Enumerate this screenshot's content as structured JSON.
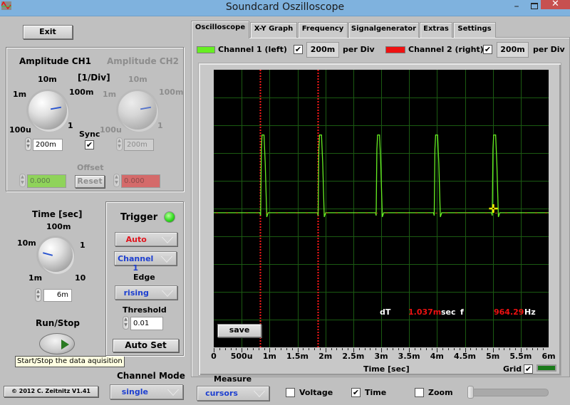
{
  "window": {
    "title": "Soundcard Oszilloscope",
    "controls": {
      "minimize": "–",
      "maximize": "□",
      "close": "✕"
    }
  },
  "left_panel": {
    "exit_label": "Exit",
    "amplitude": {
      "ch1_title": "Amplitude CH1",
      "ch2_title": "Amplitude CH2",
      "unit_label": "[1/Div]",
      "knob_labels": [
        "100u",
        "1m",
        "10m",
        "100m",
        "1"
      ],
      "ch1_value": "200m",
      "ch2_value": "200m",
      "sync_label": "Sync",
      "sync_checked": true,
      "offset_label": "Offset",
      "offset_ch1": "0.000",
      "offset_ch2": "0.000",
      "reset_label": "Reset"
    },
    "time": {
      "title": "Time [sec]",
      "knob_labels": [
        "1m",
        "10m",
        "100m",
        "1",
        "10"
      ],
      "value": "6m"
    },
    "run_stop": {
      "label": "Run/Stop",
      "tooltip": "Start/Stop the data aquisition"
    },
    "trigger": {
      "title": "Trigger",
      "mode": "Auto",
      "source": "Channel 1",
      "edge_label": "Edge",
      "edge": "rising",
      "threshold_label": "Threshold",
      "threshold": "0.01",
      "auto_set_label": "Auto Set",
      "led_color": "#33dd22"
    },
    "channel_mode": {
      "label": "Channel Mode",
      "value": "single"
    },
    "copyright": "© 2012  C. Zeitnitz V1.41"
  },
  "tabs": [
    {
      "label": "Oscilloscope",
      "active": true
    },
    {
      "label": "X-Y Graph",
      "active": false
    },
    {
      "label": "Frequency",
      "active": false
    },
    {
      "label": "Signalgenerator",
      "active": false
    },
    {
      "label": "Extras",
      "active": false
    },
    {
      "label": "Settings",
      "active": false
    }
  ],
  "channels": {
    "ch1": {
      "label": "Channel 1 (left)",
      "color": "#66ee22",
      "checked": true,
      "per_div": "200m",
      "per_div_label": "per Div"
    },
    "ch2": {
      "label": "Channel 2 (right)",
      "color": "#ee1111",
      "checked": true,
      "per_div": "200m",
      "per_div_label": "per Div"
    }
  },
  "scope": {
    "save_label": "save",
    "readout": {
      "dT_label": "dT",
      "dT_value": "1.037m",
      "dT_unit": "sec",
      "f_label": "f",
      "f_value": "964.29",
      "f_unit": "Hz"
    },
    "grid_label": "Grid",
    "grid_checked": true,
    "grid_color": "#1a7a1a"
  },
  "measure": {
    "label": "Measure",
    "mode": "cursors",
    "voltage_label": "Voltage",
    "voltage_checked": false,
    "time_label": "Time",
    "time_checked": true,
    "zoom_label": "Zoom",
    "zoom_checked": false
  },
  "chart_data": {
    "type": "line",
    "title": "",
    "xlabel": "Time [sec]",
    "ylabel": "",
    "xlim": [
      0,
      0.006
    ],
    "ylim": [
      -1,
      1
    ],
    "x_tick_labels": [
      "0",
      "500u",
      "1m",
      "1.5m",
      "2m",
      "2.5m",
      "3m",
      "3.5m",
      "4m",
      "4.5m",
      "5m",
      "5.5m",
      "6m"
    ],
    "x_ticks": [
      0,
      0.0005,
      0.001,
      0.0015,
      0.002,
      0.0025,
      0.003,
      0.0035,
      0.004,
      0.0045,
      0.005,
      0.0055,
      0.006
    ],
    "grid": true,
    "grid_divisions": {
      "x": 12,
      "y": 10
    },
    "series": [
      {
        "name": "Channel 1 (left)",
        "color": "#66ee22",
        "baseline": -0.03,
        "pulse_high": 0.53,
        "pulse_starts": [
          0.00084,
          0.00187,
          0.00291,
          0.00395,
          0.00499
        ],
        "pulse_width": 0.00011
      }
    ],
    "cursors": {
      "time_cursors": [
        0.00083,
        0.00187
      ],
      "dT": 0.001037,
      "f": 964.29,
      "marker": {
        "x": 0.00501,
        "y": 0.0
      }
    }
  }
}
